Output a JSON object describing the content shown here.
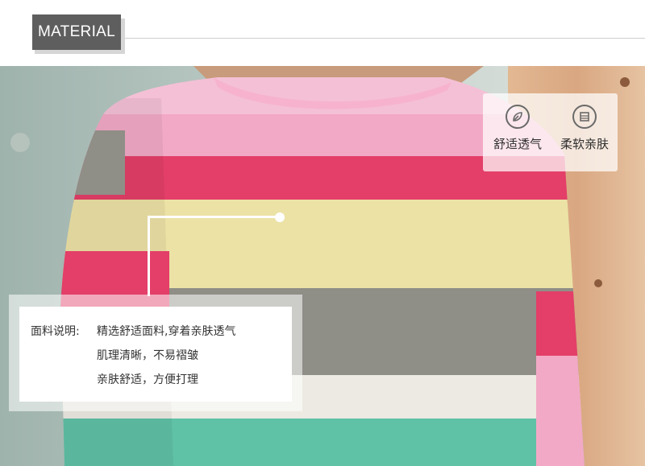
{
  "header": {
    "badge": "MATERIAL"
  },
  "features": [
    {
      "icon": "leaf-icon",
      "label": "舒适透气"
    },
    {
      "icon": "fabric-icon",
      "label": "柔软亲肤"
    }
  ],
  "description": {
    "label": "面料说明:",
    "lines": [
      "精选舒适面料,穿着亲肤透气",
      "肌理清晰，不易褶皱",
      "亲肤舒适，方便打理"
    ]
  },
  "colors": {
    "badge_bg": "#5e5e5e",
    "stripe_pink": "#f2a9c6",
    "stripe_red": "#e33f68",
    "stripe_yellow": "#ece2a6",
    "stripe_gray": "#8f8e87",
    "stripe_white": "#eceae2",
    "stripe_teal": "#5fc1a6"
  }
}
